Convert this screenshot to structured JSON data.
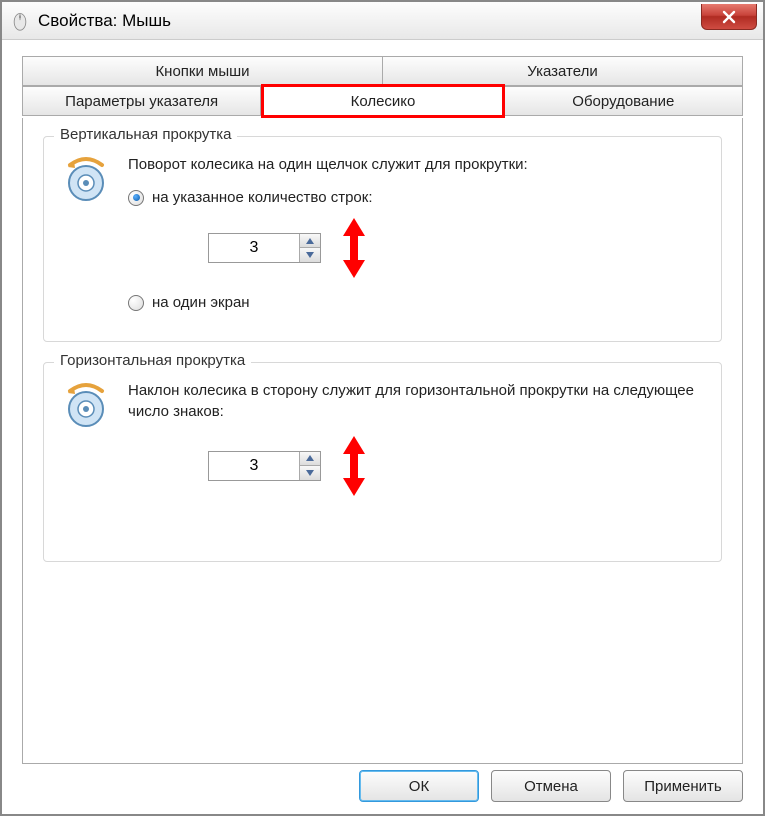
{
  "window": {
    "title": "Свойства: Мышь"
  },
  "tabs": {
    "row1": [
      "Кнопки мыши",
      "Указатели"
    ],
    "row2": [
      "Параметры указателя",
      "Колесико",
      "Оборудование"
    ],
    "active": "Колесико"
  },
  "vertical_scroll": {
    "title": "Вертикальная прокрутка",
    "description": "Поворот колесика на один щелчок служит для прокрутки:",
    "radio_lines": "на указанное количество строк:",
    "radio_screen": "на один экран",
    "lines_value": "3",
    "selected": "lines"
  },
  "horizontal_scroll": {
    "title": "Горизонтальная прокрутка",
    "description": "Наклон колесика в сторону служит для горизонтальной прокрутки на следующее число знаков:",
    "chars_value": "3"
  },
  "buttons": {
    "ok": "ОК",
    "cancel": "Отмена",
    "apply": "Применить"
  }
}
